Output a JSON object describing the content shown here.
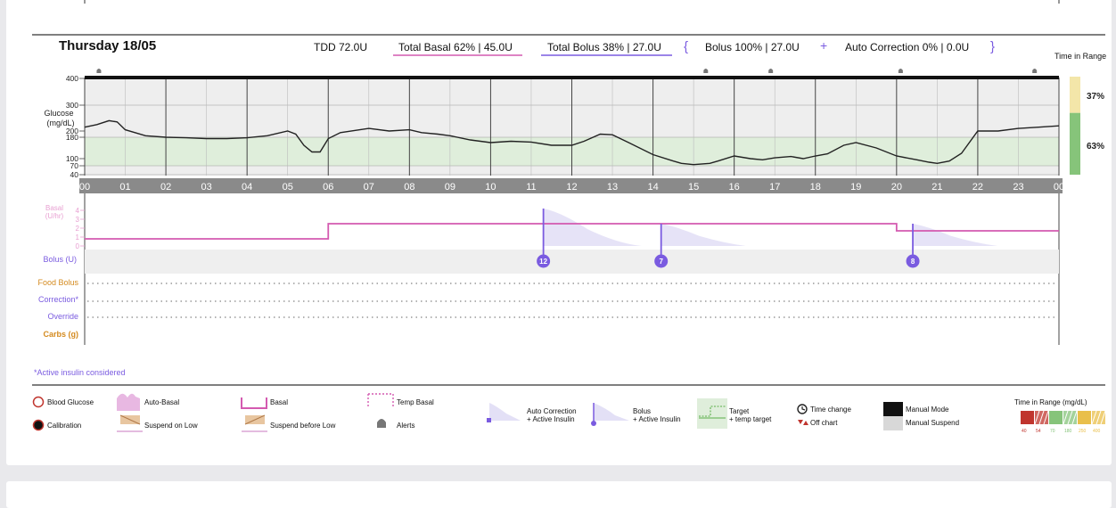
{
  "header": {
    "day": "Thursday 18/05",
    "tdd": "TDD 72.0U",
    "total_basal": "Total Basal 62% | 45.0U",
    "total_bolus": "Total Bolus 38% | 27.0U",
    "brace_open": "{",
    "bolus_pct": "Bolus 100% | 27.0U",
    "plus": "+",
    "auto_correction": "Auto Correction 0% | 0.0U",
    "brace_close": "}",
    "time_in_range_title": "Time in Range",
    "tir_high_pct": "37%",
    "tir_in_pct": "63%"
  },
  "colors": {
    "basal": "#d45ab0",
    "bolus": "#7a5be0",
    "target_band": "#dfeedb",
    "glucose_line": "#222222",
    "tir_high": "#f3e6a9",
    "tir_in": "#86c47a",
    "food": "#d48a1e"
  },
  "glucose_axis": {
    "title_line1": "Glucose",
    "title_line2": "(mg/dL)",
    "ticks": [
      "400",
      "300",
      "200",
      "180",
      "100",
      "70",
      "40"
    ]
  },
  "basal_axis": {
    "title_line1": "Basal",
    "title_line2": "(U/hr)",
    "ticks": [
      "4",
      "3",
      "2",
      "1",
      "0"
    ]
  },
  "hour_labels": [
    "00",
    "01",
    "02",
    "03",
    "04",
    "05",
    "06",
    "07",
    "08",
    "09",
    "10",
    "11",
    "12",
    "13",
    "14",
    "15",
    "16",
    "17",
    "18",
    "19",
    "20",
    "21",
    "22",
    "23",
    "00"
  ],
  "row_labels": {
    "bolus": "Bolus (U)",
    "food": "Food Bolus",
    "correction": "Correction*",
    "override": "Override",
    "carbs": "Carbs (g)"
  },
  "footnote": "*Active insulin considered",
  "legend": {
    "blood_glucose": "Blood Glucose",
    "calibration": "Calibration",
    "auto_basal": "Auto-Basal",
    "suspend_on_low": "Suspend on Low",
    "basal": "Basal",
    "suspend_before_low": "Suspend before Low",
    "temp_basal": "Temp Basal",
    "alerts": "Alerts",
    "auto_correction_1": "Auto Correction",
    "auto_correction_2": "+ Active Insulin",
    "bolus_1": "Bolus",
    "bolus_2": "+ Active Insulin",
    "target_1": "Target",
    "target_2": "+ temp target",
    "time_change": "Time change",
    "off_chart": "Off chart",
    "manual_mode": "Manual Mode",
    "manual_suspend": "Manual Suspend",
    "tir_title": "Time in Range (mg/dL)",
    "tir_scale": [
      "40",
      "54",
      "70",
      "180",
      "250",
      "400"
    ],
    "tir_colors": [
      "#c0352e",
      "#c0352e",
      "#86c47a",
      "#86c47a",
      "#e9bf4a",
      "#e9bf4a"
    ]
  },
  "chart_data": {
    "type": "line",
    "x_unit": "hour",
    "xlim": [
      0,
      24
    ],
    "glucose": {
      "ylabel": "Glucose (mg/dL)",
      "target_range": [
        70,
        180
      ],
      "points": [
        [
          0,
          215
        ],
        [
          0.3,
          225
        ],
        [
          0.6,
          240
        ],
        [
          0.8,
          235
        ],
        [
          1,
          205
        ],
        [
          1.5,
          185
        ],
        [
          2,
          180
        ],
        [
          2.5,
          178
        ],
        [
          3,
          175
        ],
        [
          3.5,
          175
        ],
        [
          4,
          178
        ],
        [
          4.5,
          185
        ],
        [
          5,
          200
        ],
        [
          5.2,
          190
        ],
        [
          5.4,
          150
        ],
        [
          5.6,
          125
        ],
        [
          5.8,
          125
        ],
        [
          6,
          175
        ],
        [
          6.3,
          195
        ],
        [
          7,
          210
        ],
        [
          7.5,
          200
        ],
        [
          8,
          205
        ],
        [
          8.3,
          195
        ],
        [
          8.7,
          190
        ],
        [
          9,
          185
        ],
        [
          9.5,
          170
        ],
        [
          10,
          160
        ],
        [
          10.5,
          165
        ],
        [
          11,
          162
        ],
        [
          11.5,
          150
        ],
        [
          12,
          150
        ],
        [
          12.3,
          165
        ],
        [
          12.7,
          190
        ],
        [
          13,
          188
        ],
        [
          13.4,
          160
        ],
        [
          14,
          115
        ],
        [
          14.5,
          90
        ],
        [
          14.7,
          80
        ],
        [
          15,
          75
        ],
        [
          15.4,
          80
        ],
        [
          15.6,
          90
        ],
        [
          16,
          110
        ],
        [
          16.4,
          100
        ],
        [
          16.7,
          95
        ],
        [
          17,
          103
        ],
        [
          17.4,
          108
        ],
        [
          17.7,
          100
        ],
        [
          18,
          110
        ],
        [
          18.3,
          118
        ],
        [
          18.7,
          150
        ],
        [
          19,
          160
        ],
        [
          19.5,
          140
        ],
        [
          20,
          110
        ],
        [
          20.5,
          95
        ],
        [
          20.8,
          85
        ],
        [
          21,
          80
        ],
        [
          21.3,
          90
        ],
        [
          21.6,
          120
        ],
        [
          22,
          200
        ],
        [
          22.5,
          200
        ],
        [
          23,
          210
        ],
        [
          23.5,
          215
        ],
        [
          24,
          220
        ]
      ]
    },
    "basal": {
      "ylabel": "Basal (U/hr)",
      "ylim": [
        0,
        4
      ],
      "steps": [
        [
          0,
          0.8
        ],
        [
          6,
          2.5
        ],
        [
          20,
          1.7
        ],
        [
          24,
          1.7
        ]
      ]
    },
    "boluses": [
      {
        "hour": 11.3,
        "units": 12
      },
      {
        "hour": 14.2,
        "units": 7
      },
      {
        "hour": 20.4,
        "units": 8
      }
    ],
    "alerts_hours": [
      0.35,
      15.3,
      16.9,
      20.1,
      23.4
    ],
    "time_in_range": [
      {
        "range": "above 180",
        "percent": 37
      },
      {
        "range": "70-180",
        "percent": 63
      }
    ]
  }
}
